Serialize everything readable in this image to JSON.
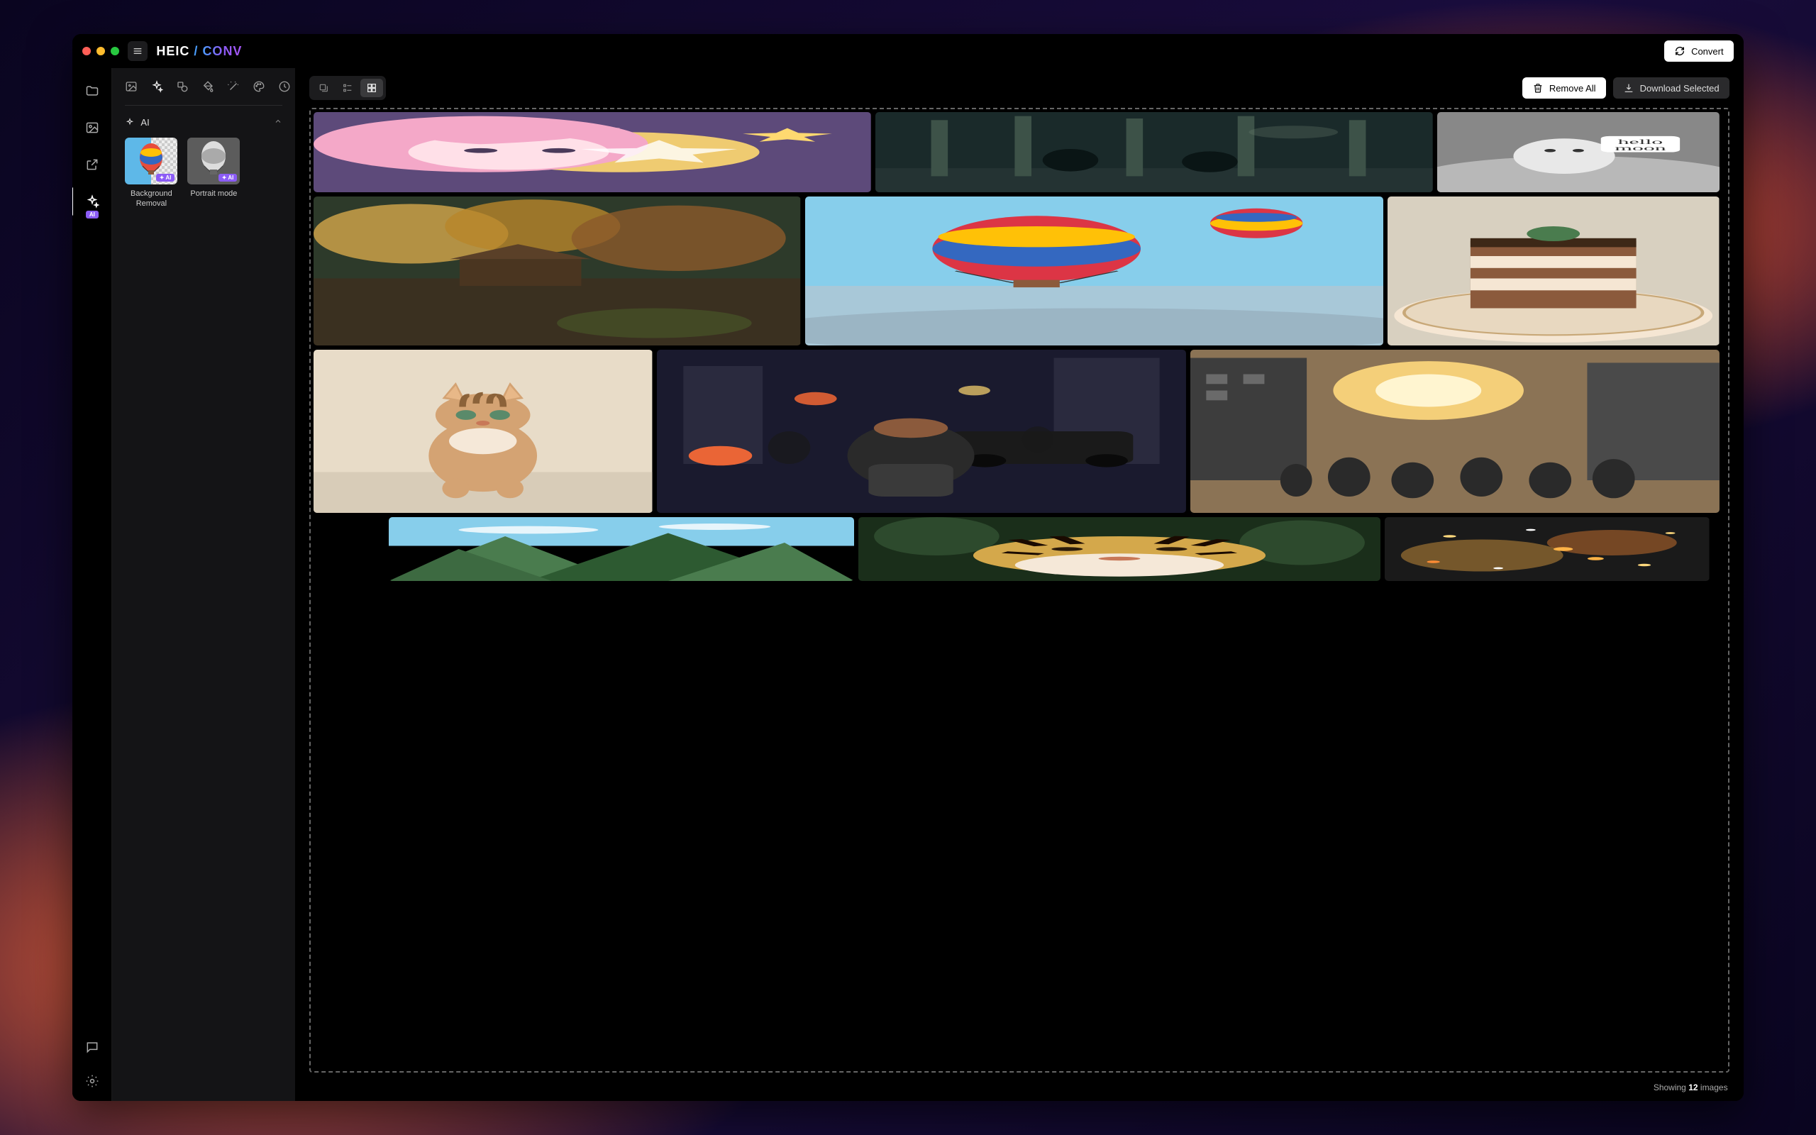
{
  "app": {
    "logo_part1": "HEIC",
    "logo_slash": "/",
    "logo_part2": "CONV"
  },
  "titlebar": {
    "convert_label": "Convert"
  },
  "rail": {
    "items": [
      {
        "name": "folder-icon"
      },
      {
        "name": "image-icon"
      },
      {
        "name": "export-icon"
      },
      {
        "name": "ai-sparkle-icon",
        "active": true,
        "badge": "AI"
      }
    ],
    "bottom_items": [
      {
        "name": "chat-icon"
      },
      {
        "name": "settings-icon"
      }
    ]
  },
  "side_panel": {
    "tool_icons": [
      "image-tool-icon",
      "ai-sparkle-tool-icon",
      "shape-tool-icon",
      "fill-tool-icon",
      "wand-tool-icon",
      "palette-tool-icon",
      "time-tool-icon"
    ],
    "section_title": "AI",
    "ai_badge_label": "AI",
    "cards": [
      {
        "label": "Background Removal"
      },
      {
        "label": "Portrait mode"
      }
    ]
  },
  "main_toolbar": {
    "view_modes": [
      {
        "name": "stack-view"
      },
      {
        "name": "list-view"
      },
      {
        "name": "grid-view",
        "active": true
      }
    ],
    "remove_all_label": "Remove All",
    "download_selected_label": "Download Selected"
  },
  "gallery": {
    "images": [
      {
        "name": "anime-girl-stars",
        "palette": [
          "#f4a8c8",
          "#ffd970",
          "#5d4a7a"
        ]
      },
      {
        "name": "samurai-forest",
        "palette": [
          "#1a2a2a",
          "#3d5248",
          "#6b7d6e"
        ]
      },
      {
        "name": "hello-moon-figure",
        "palette": [
          "#b8b8b8",
          "#e8e8e8",
          "#888"
        ],
        "note": "hello moon"
      },
      {
        "name": "autumn-lake-cabin",
        "palette": [
          "#8b5a2b",
          "#d4a84b",
          "#2d3a2a"
        ]
      },
      {
        "name": "hot-air-balloons",
        "palette": [
          "#87ceeb",
          "#dc3545",
          "#ffc107"
        ]
      },
      {
        "name": "tiramisu-dessert",
        "palette": [
          "#8b5a3c",
          "#f5e6d3",
          "#3d2817"
        ]
      },
      {
        "name": "orange-kitten",
        "palette": [
          "#d4a373",
          "#8b6239",
          "#e8dcc8"
        ]
      },
      {
        "name": "city-street-night",
        "palette": [
          "#1a1a2e",
          "#ff6b35",
          "#4a4a6a"
        ]
      },
      {
        "name": "city-sunset-crowd",
        "palette": [
          "#ffd97d",
          "#8b7355",
          "#3d3d3d"
        ]
      },
      {
        "name": "green-mountains",
        "palette": [
          "#4a7c4e",
          "#87ceeb",
          "#2d5a31"
        ]
      },
      {
        "name": "tiger-jungle",
        "palette": [
          "#d4a84b",
          "#2d4a2d",
          "#1a2e1a"
        ]
      },
      {
        "name": "golden-sparkles",
        "palette": [
          "#ffb347",
          "#8b5a2b",
          "#1a1a1a"
        ]
      }
    ]
  },
  "status": {
    "prefix": "Showing ",
    "count": "12",
    "suffix": " images"
  }
}
